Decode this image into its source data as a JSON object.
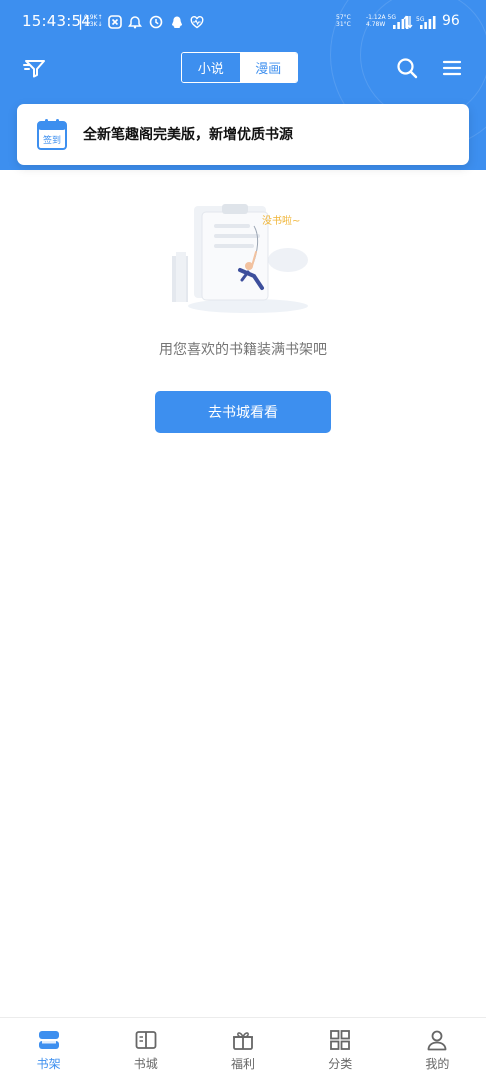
{
  "status_bar": {
    "time": "15:43:54",
    "separator": "|",
    "speed_up": "0.9K↑",
    "speed_down": "1.3K↓",
    "temp_top": "57°C",
    "temp_bottom": "31°C",
    "current": "-1.12A 5G",
    "power": "4.78W",
    "battery": "96"
  },
  "toolbar": {
    "tabs": [
      {
        "label": "小说",
        "active": false
      },
      {
        "label": "漫画",
        "active": true
      }
    ]
  },
  "checkin": {
    "icon_label": "签到",
    "message": "全新笔趣阁完美版，新增优质书源"
  },
  "empty_state": {
    "bubble_text": "没书啦~",
    "message": "用您喜欢的书籍装满书架吧",
    "button_label": "去书城看看"
  },
  "tab_bar": {
    "items": [
      {
        "label": "书架",
        "icon": "bookshelf-icon",
        "active": true
      },
      {
        "label": "书城",
        "icon": "open-book-icon",
        "active": false
      },
      {
        "label": "福利",
        "icon": "gift-icon",
        "active": false
      },
      {
        "label": "分类",
        "icon": "grid-icon",
        "active": false
      },
      {
        "label": "我的",
        "icon": "person-icon",
        "active": false
      }
    ]
  },
  "colors": {
    "primary": "#3d8fef",
    "text_secondary": "#757575"
  }
}
